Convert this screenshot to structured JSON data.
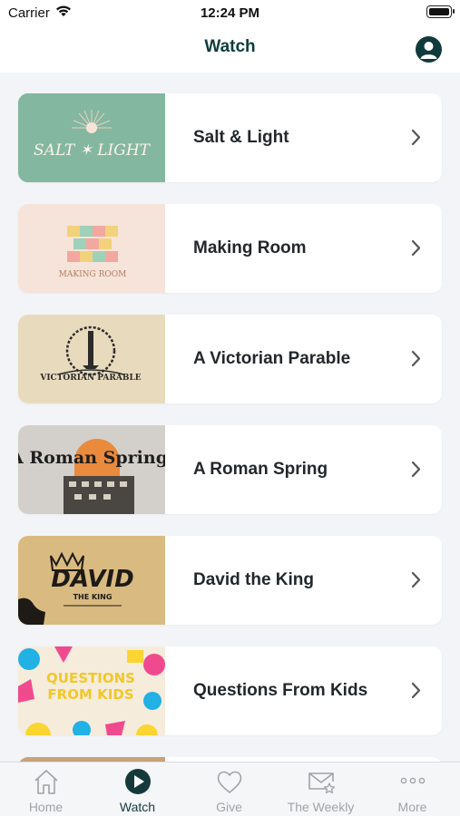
{
  "status_bar": {
    "carrier": "Carrier",
    "time": "12:24 PM"
  },
  "nav": {
    "title": "Watch"
  },
  "series": [
    {
      "title": "Salt & Light",
      "art_text": "SALT ✶ LIGHT",
      "accent": "#7fb59d"
    },
    {
      "title": "Making Room",
      "art_text": "MAKING ROOM",
      "accent": "#f4ddd3"
    },
    {
      "title": "A Victorian Parable",
      "art_text": "VICTORIAN PARABLE",
      "accent": "#e6d7b8"
    },
    {
      "title": "A Roman Spring",
      "art_text": "A Roman Spring",
      "accent": "#c9c6c3"
    },
    {
      "title": "David the King",
      "art_text": "DAVID",
      "art_subtext": "THE KING",
      "accent": "#d8b679"
    },
    {
      "title": "Questions From Kids",
      "art_text": "QUESTIONS FROM KIDS",
      "accent": "#f4e9d8"
    }
  ],
  "tabs": [
    {
      "label": "Home",
      "icon": "home-icon",
      "active": false
    },
    {
      "label": "Watch",
      "icon": "play-circle-icon",
      "active": true
    },
    {
      "label": "Give",
      "icon": "heart-icon",
      "active": false
    },
    {
      "label": "The Weekly",
      "icon": "envelope-star-icon",
      "active": false
    },
    {
      "label": "More",
      "icon": "ellipsis-icon",
      "active": false
    }
  ]
}
